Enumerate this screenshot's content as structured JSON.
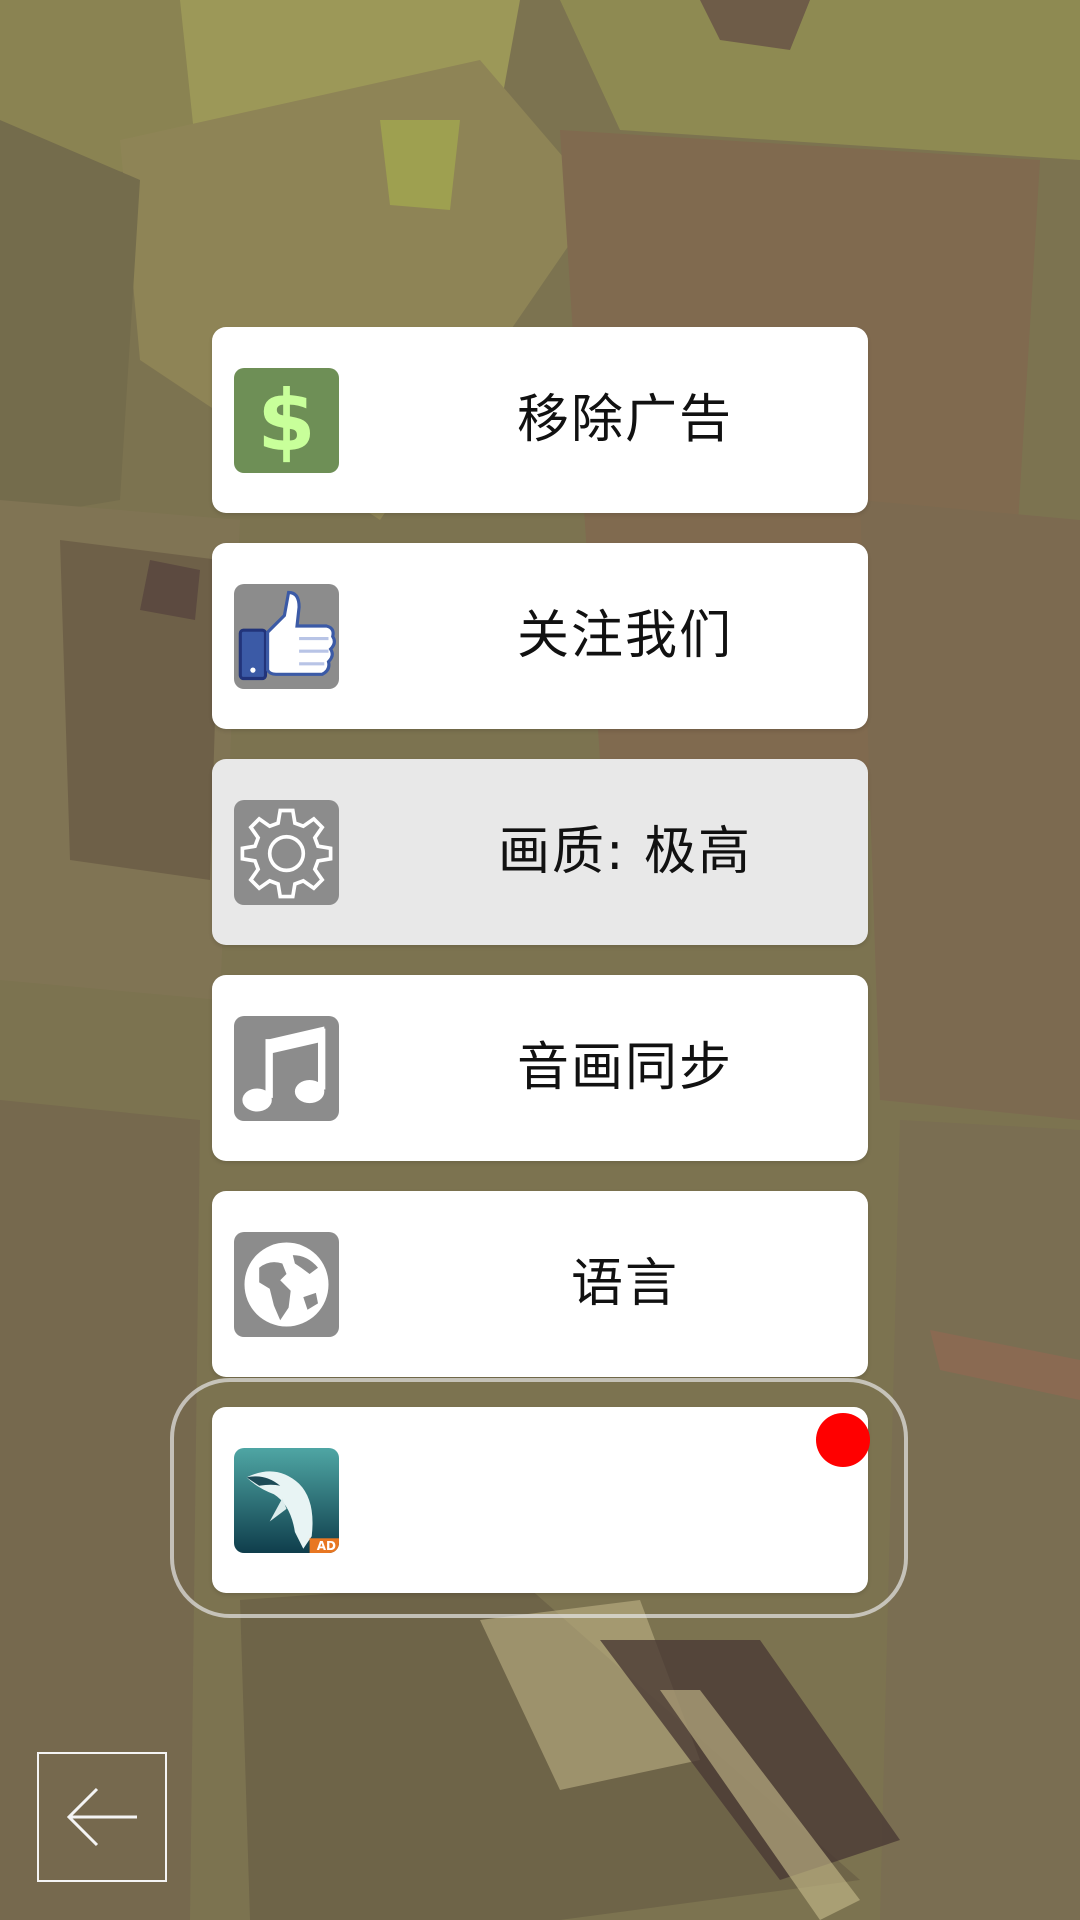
{
  "menu": {
    "items": [
      {
        "label": "移除广告",
        "icon": "dollar-icon"
      },
      {
        "label": "关注我们",
        "icon": "thumbs-up-icon"
      },
      {
        "label": "画质: 极高",
        "icon": "gear-icon",
        "selected": true
      },
      {
        "label": "音画同步",
        "icon": "music-note-icon"
      },
      {
        "label": "语言",
        "icon": "globe-icon"
      }
    ],
    "ad_item": {
      "icon": "whale-ad-icon",
      "badge": "AD",
      "notification_color": "#ff0000"
    }
  },
  "back_button": {
    "icon": "arrow-left-icon"
  },
  "colors": {
    "button_bg": "#ffffff",
    "button_selected_bg": "#e8e8e8",
    "icon_gray": "#8c8c8c",
    "dollar_bg": "#6e8f56",
    "dollar_fg": "#c8ff9a"
  }
}
